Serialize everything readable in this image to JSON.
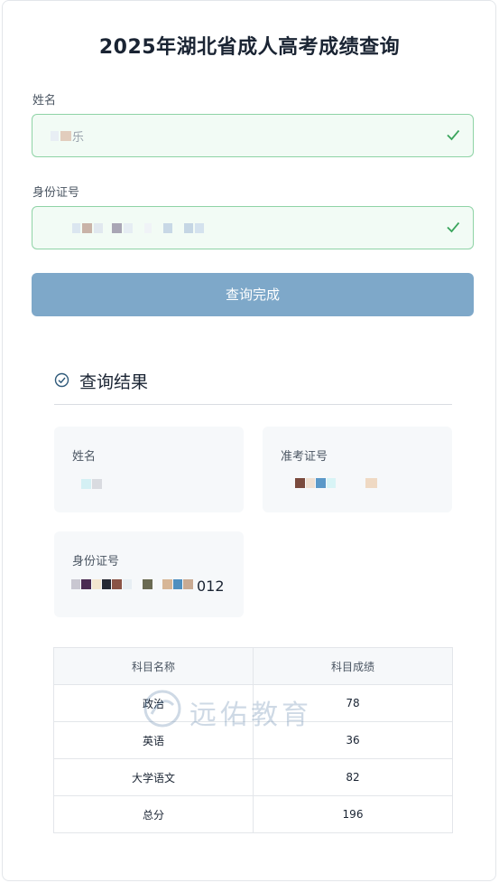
{
  "page_title": "2025年湖北省成人高考成绩查询",
  "form": {
    "name_label": "姓名",
    "name_value_visible": "乐",
    "id_label": "身份证号",
    "submit_label": "查询完成"
  },
  "result": {
    "heading": "查询结果",
    "name_label": "姓名",
    "ticket_label": "准考证号",
    "id_label": "身份证号",
    "id_visible_suffix": "012"
  },
  "scores": {
    "headers": [
      "科目名称",
      "科目成绩"
    ],
    "rows": [
      [
        "政治",
        "78"
      ],
      [
        "英语",
        "36"
      ],
      [
        "大学语文",
        "82"
      ],
      [
        "总分",
        "196"
      ]
    ]
  },
  "watermark": {
    "text": "远佑教育"
  },
  "colors": {
    "field_border": "#8fd3a6",
    "field_bg": "#f2fbf5",
    "check": "#3aa55c",
    "button": "#7ea8c9",
    "heading_icon": "#2f5a7a"
  }
}
